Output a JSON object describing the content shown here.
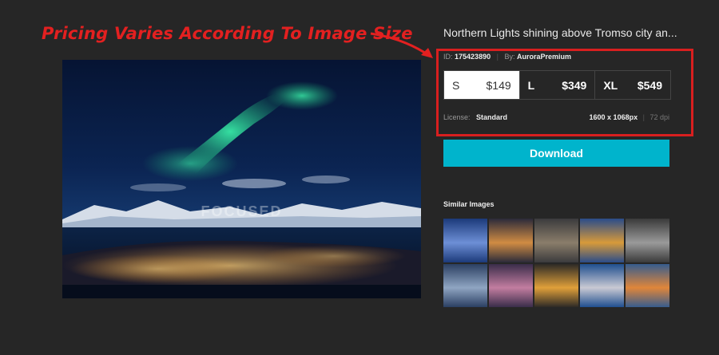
{
  "annotation": {
    "text": "Pricing Varies According To Image Size"
  },
  "watermark": "FOCUSED",
  "title": "Northern Lights shining above Tromso city an...",
  "meta": {
    "id_label": "ID:",
    "id_value": "175423890",
    "by_label": "By:",
    "by_value": "AuroraPremium"
  },
  "sizes": [
    {
      "name": "S",
      "price": "$149",
      "selected": true
    },
    {
      "name": "L",
      "price": "$349",
      "selected": false
    },
    {
      "name": "XL",
      "price": "$549",
      "selected": false
    }
  ],
  "license": {
    "label": "License:",
    "value": "Standard",
    "resolution": "1600 x 1068px",
    "dpi": "72 dpi"
  },
  "download_label": "Download",
  "similar_title": "Similar Images",
  "thumbnails": [
    {
      "name": "thumb-1",
      "colors": [
        "#1c3a7a",
        "#6d8fd6"
      ]
    },
    {
      "name": "thumb-2",
      "colors": [
        "#2b2a3a",
        "#d08c43"
      ]
    },
    {
      "name": "thumb-3",
      "colors": [
        "#3b3b3d",
        "#8a7d6a"
      ]
    },
    {
      "name": "thumb-4",
      "colors": [
        "#2a4c8a",
        "#d79a3a"
      ]
    },
    {
      "name": "thumb-5",
      "colors": [
        "#3a3a3a",
        "#9a9a9a"
      ]
    },
    {
      "name": "thumb-6",
      "colors": [
        "#2b3f62",
        "#8fa5c2"
      ]
    },
    {
      "name": "thumb-7",
      "colors": [
        "#3a2d4a",
        "#c27da0"
      ]
    },
    {
      "name": "thumb-8",
      "colors": [
        "#2d2a26",
        "#e0a03a"
      ]
    },
    {
      "name": "thumb-9",
      "colors": [
        "#1f4f8f",
        "#c9c9d3"
      ]
    },
    {
      "name": "thumb-10",
      "colors": [
        "#365c8d",
        "#e0863a"
      ]
    }
  ]
}
